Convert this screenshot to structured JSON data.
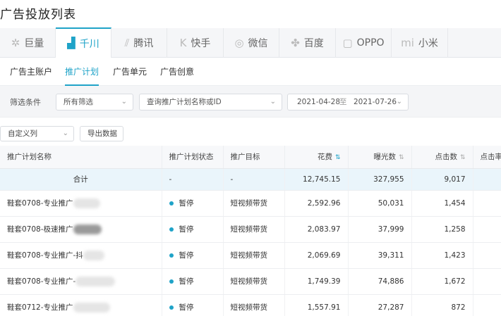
{
  "page": {
    "title": "广告投放列表"
  },
  "platform_tabs": [
    {
      "label": "巨量",
      "icon": "juliang-icon",
      "glyph": "✲",
      "active": false
    },
    {
      "label": "千川",
      "icon": "qianchuan-icon",
      "glyph": "▟",
      "active": true
    },
    {
      "label": "腾讯",
      "icon": "tencent-icon",
      "glyph": "⫽",
      "active": false
    },
    {
      "label": "快手",
      "icon": "kuaishou-icon",
      "glyph": "K",
      "active": false
    },
    {
      "label": "微信",
      "icon": "wechat-icon",
      "glyph": "◎",
      "active": false
    },
    {
      "label": "百度",
      "icon": "baidu-paw-icon",
      "glyph": "✤",
      "active": false
    },
    {
      "label": "OPPO",
      "icon": "oppo-icon",
      "glyph": "▢",
      "active": false
    },
    {
      "label": "小米",
      "icon": "xiaomi-icon",
      "glyph": "mi",
      "active": false
    }
  ],
  "sub_tabs": [
    {
      "label": "广告主账户",
      "active": false
    },
    {
      "label": "推广计划",
      "active": true
    },
    {
      "label": "广告单元",
      "active": false
    },
    {
      "label": "广告创意",
      "active": false
    }
  ],
  "filters": {
    "label": "筛选条件",
    "scope_select": "所有筛选",
    "search_placeholder": "查询推广计划名称或ID",
    "date_from": "2021-04-28",
    "date_sep": "至",
    "date_to": "2021-07-26"
  },
  "toolbar": {
    "custom_columns": "自定义列",
    "export": "导出数据"
  },
  "table": {
    "headers": {
      "name": "推广计划名称",
      "status": "推广计划状态",
      "goal": "推广目标",
      "cost": "花费",
      "impressions": "曝光数",
      "clicks": "点击数",
      "ctr": "点击率"
    },
    "total": {
      "label": "合计",
      "status": "-",
      "goal": "-",
      "cost": "12,745.15",
      "impressions": "327,955",
      "clicks": "9,017"
    },
    "rows": [
      {
        "name": "鞋套0708-专业推广",
        "status": "暂停",
        "goal": "短视频带货",
        "cost": "2,592.96",
        "impressions": "50,031",
        "clicks": "1,454"
      },
      {
        "name": "鞋套0708-极速推广",
        "status": "暂停",
        "goal": "短视频带货",
        "cost": "2,083.97",
        "impressions": "37,999",
        "clicks": "1,258"
      },
      {
        "name": "鞋套0708-专业推广-抖",
        "status": "暂停",
        "goal": "短视频带货",
        "cost": "2,069.69",
        "impressions": "39,311",
        "clicks": "1,423"
      },
      {
        "name": "鞋套0708-专业推广-",
        "status": "暂停",
        "goal": "短视频带货",
        "cost": "1,749.39",
        "impressions": "74,886",
        "clicks": "1,672"
      },
      {
        "name": "鞋套0712-专业推广",
        "status": "暂停",
        "goal": "短视频带货",
        "cost": "1,557.91",
        "impressions": "27,287",
        "clicks": "872"
      }
    ]
  },
  "colors": {
    "accent": "#1fa3c8",
    "total_row_bg": "#eaf5fb",
    "filter_bg": "#f4f5f7"
  }
}
